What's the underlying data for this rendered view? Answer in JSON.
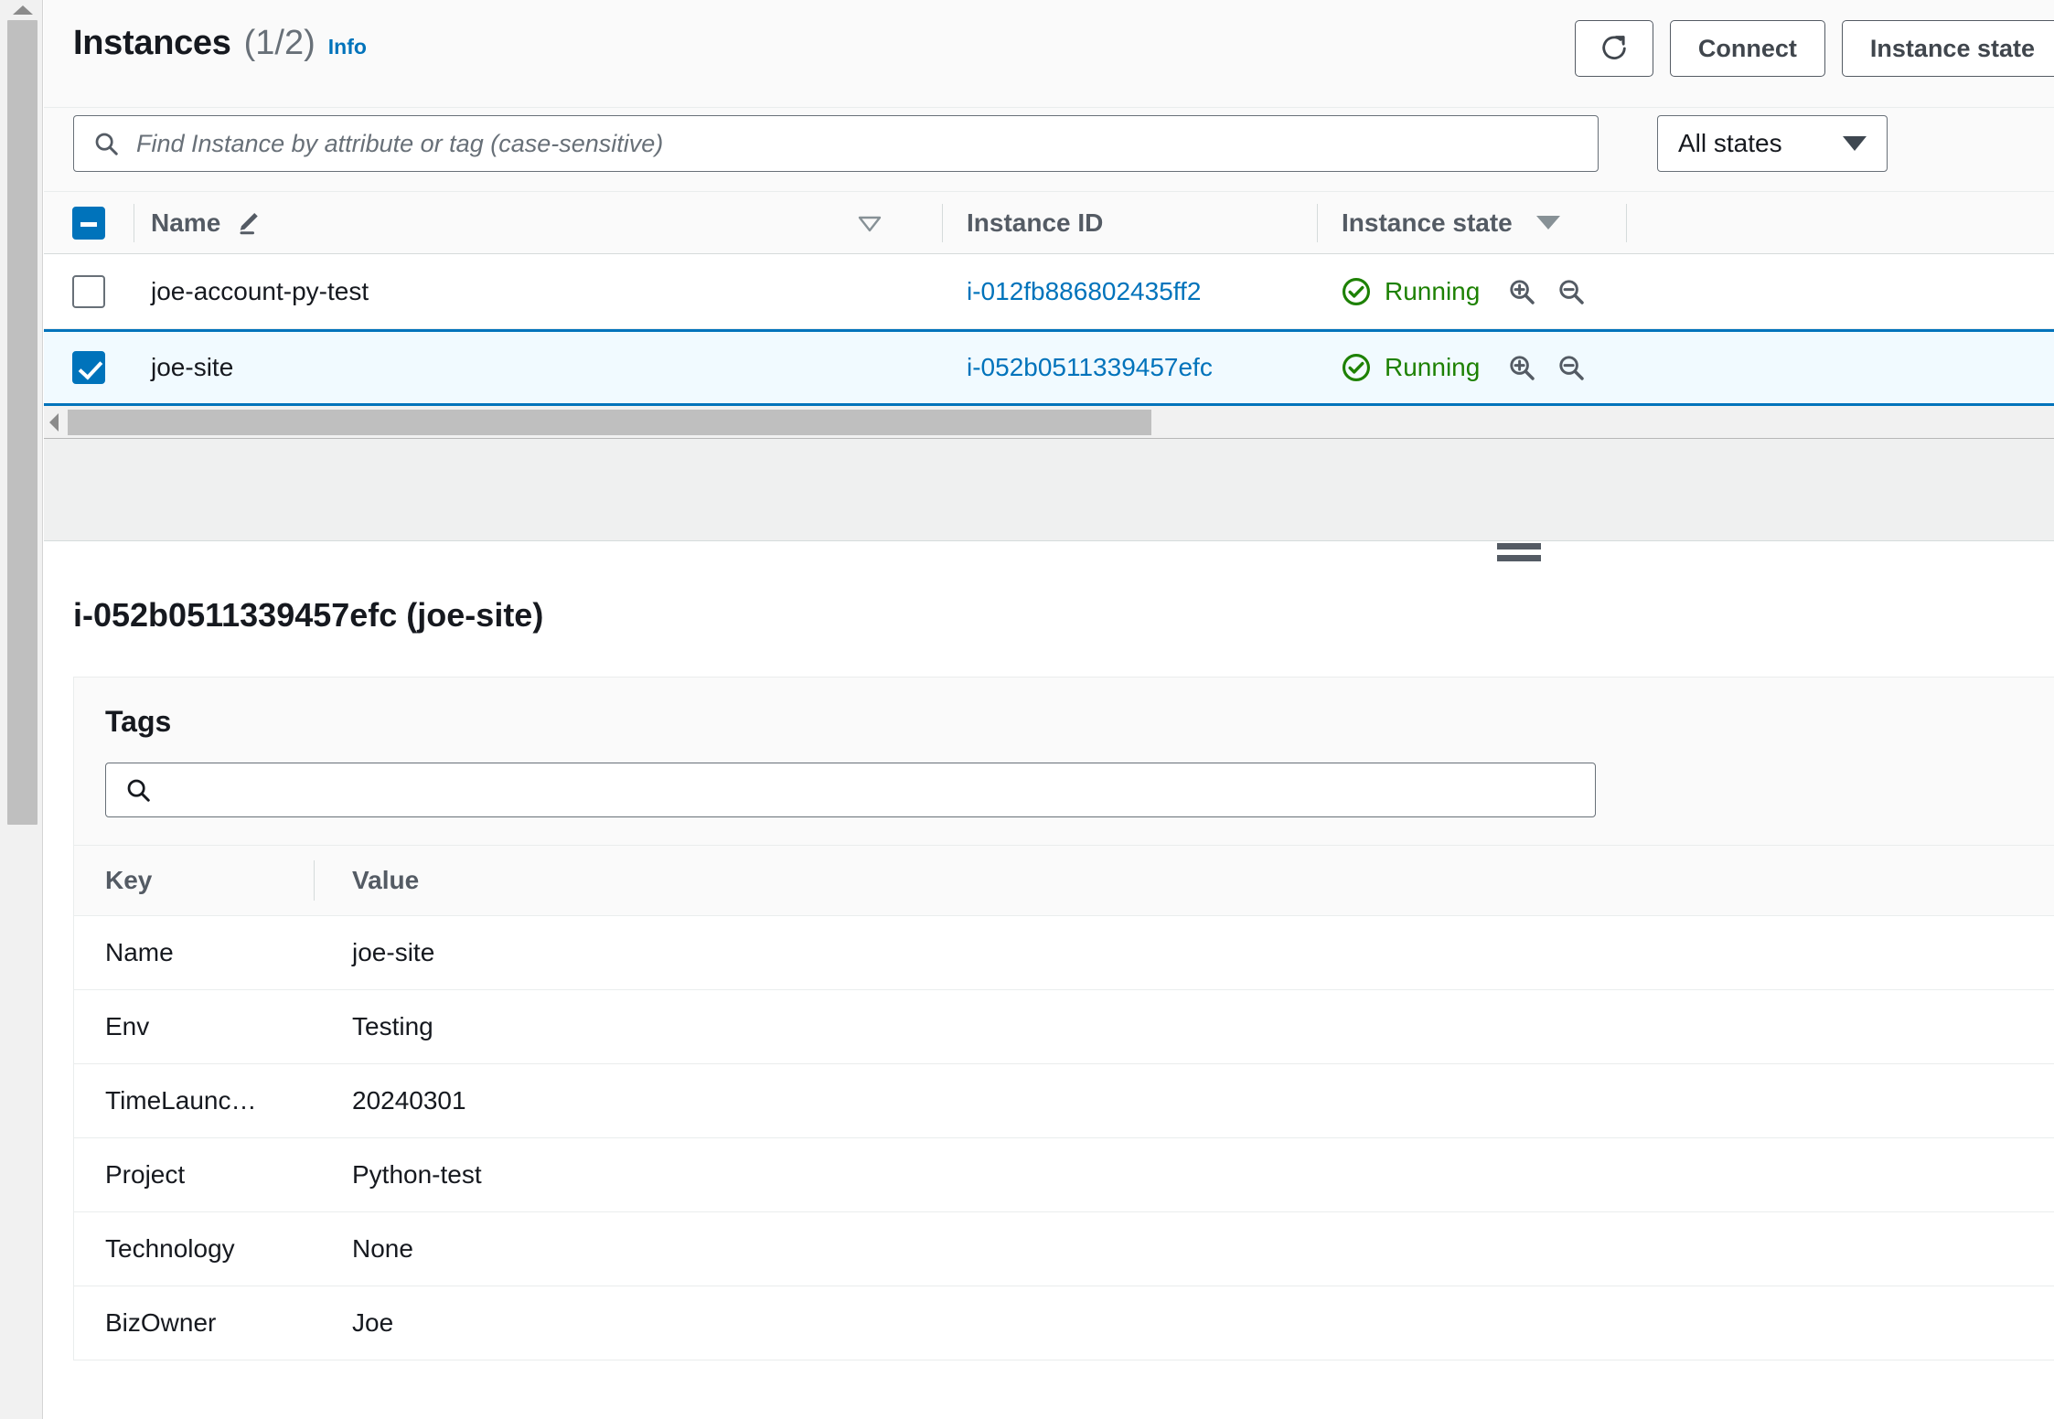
{
  "panel": {
    "title": "Instances",
    "count": "(1/2)",
    "info_link": "Info",
    "actions": [
      {
        "name": "refresh-button",
        "label": "",
        "icon": "refresh-icon"
      },
      {
        "name": "connect-button",
        "label": "Connect",
        "icon": ""
      },
      {
        "name": "instance-state-button",
        "label": "Instance state",
        "icon": ""
      }
    ]
  },
  "filter": {
    "search_value": "",
    "search_placeholder": "Find Instance by attribute or tag (case-sensitive)",
    "search_icon": "search-icon",
    "state_filter_value": "All states"
  },
  "instances_table": {
    "select_all_state": "indeterminate",
    "columns": {
      "name": "Name",
      "instance_id": "Instance ID",
      "instance_state": "Instance state"
    },
    "rows": [
      {
        "checked": false,
        "name": "joe-account-py-test",
        "instance_id": "i-012fb886802435ff2",
        "state": "Running",
        "state_color": "#1d8102"
      },
      {
        "checked": true,
        "name": "joe-site",
        "instance_id": "i-052b0511339457efc",
        "state": "Running",
        "state_color": "#1d8102"
      }
    ]
  },
  "detail": {
    "heading": "i-052b0511339457efc (joe-site)",
    "tags": {
      "section_title": "Tags",
      "search_value": "",
      "search_placeholder": "",
      "columns": {
        "key": "Key",
        "value": "Value"
      },
      "rows": [
        {
          "key": "Name",
          "value": "joe-site"
        },
        {
          "key": "Env",
          "value": "Testing"
        },
        {
          "key": "TimeLaunc…",
          "value": "20240301"
        },
        {
          "key": "Project",
          "value": "Python-test"
        },
        {
          "key": "Technology",
          "value": "None"
        },
        {
          "key": "BizOwner",
          "value": "Joe"
        }
      ]
    }
  },
  "colors": {
    "accent": "#0073bb",
    "running": "#1d8102",
    "selected_row_bg": "#f1faff",
    "header_bg": "#fafafa"
  }
}
